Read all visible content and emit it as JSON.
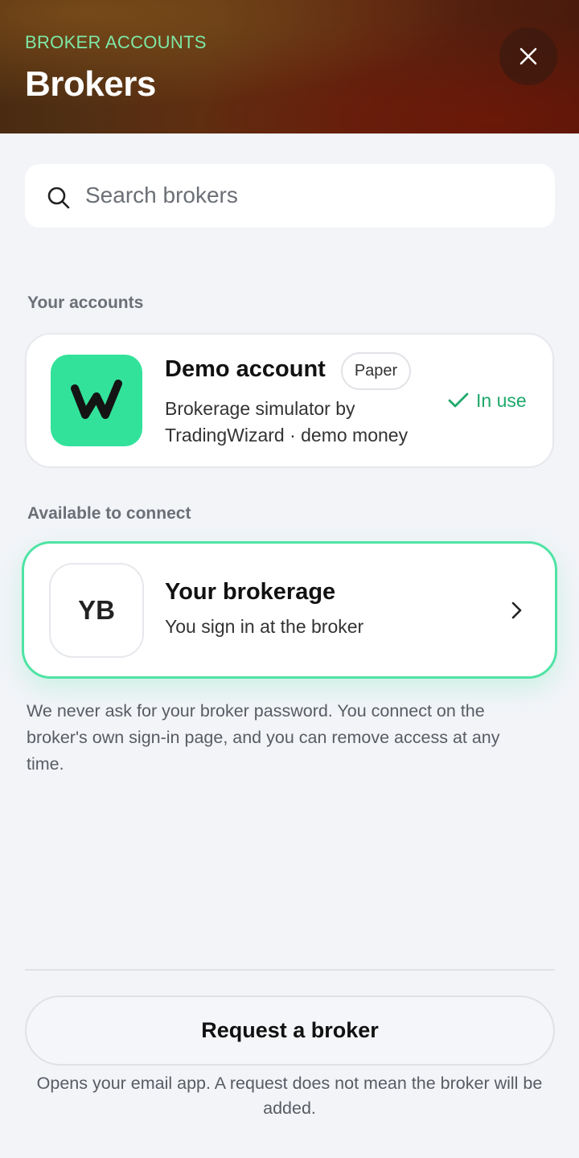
{
  "header": {
    "eyebrow": "BROKER ACCOUNTS",
    "title": "Brokers",
    "close_icon": "close-icon"
  },
  "search": {
    "placeholder": "Search brokers",
    "value": "",
    "icon": "search-icon"
  },
  "your_accounts": {
    "label": "Your accounts",
    "account": {
      "logo_icon": "tradingwizard-w-logo",
      "name": "Demo account",
      "badge": "Paper",
      "description": "Brokerage simulator by TradingWizard · demo money",
      "status": "In use",
      "status_icon": "checkmark-icon"
    }
  },
  "available": {
    "label": "Available to connect",
    "broker": {
      "initials": "YB",
      "name": "Your brokerage",
      "subtitle": "You sign in at the broker",
      "icon": "chevron-right-icon"
    }
  },
  "security_note": "We never ask for your broker password. You connect on the broker's own sign-in page, and you can remove access at any time.",
  "footer": {
    "request_button": "Request a broker",
    "request_note": "Opens your email app. A request does not mean the broker will be added."
  },
  "colors": {
    "accent_green": "#33e29a",
    "status_green": "#1ea86a",
    "eyebrow_green": "#7ee8a6",
    "background": "#f2f4f8"
  }
}
